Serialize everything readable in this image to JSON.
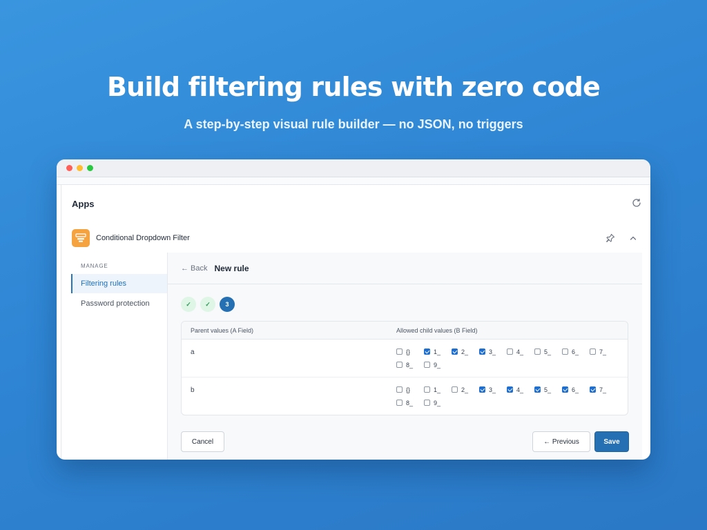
{
  "hero": {
    "title": "Build filtering rules with zero code",
    "subtitle": "A step-by-step visual rule builder — no JSON, no triggers"
  },
  "window": {
    "controls": [
      "close",
      "minimize",
      "maximize"
    ]
  },
  "apps": {
    "header": "Apps",
    "refresh_icon": "refresh-icon"
  },
  "app": {
    "name": "Conditional Dropdown Filter",
    "logo_color": "#f5a340",
    "pin_icon": "pin-icon",
    "collapse_icon": "chevron-up-icon"
  },
  "sidebar": {
    "section": "MANAGE",
    "items": [
      {
        "label": "Filtering rules",
        "active": true
      },
      {
        "label": "Password protection",
        "active": false
      }
    ]
  },
  "content": {
    "back_label": "← Back",
    "title": "New rule",
    "steps": [
      {
        "label": "✓",
        "state": "done"
      },
      {
        "label": "✓",
        "state": "done"
      },
      {
        "label": "3",
        "state": "current"
      }
    ],
    "table": {
      "col_a": "Parent values (A Field)",
      "col_b": "Allowed child values (B Field)",
      "rows": [
        {
          "parent": "a",
          "options": [
            {
              "label": "{}",
              "checked": false
            },
            {
              "label": "1_",
              "checked": true
            },
            {
              "label": "2_",
              "checked": true
            },
            {
              "label": "3_",
              "checked": true
            },
            {
              "label": "4_",
              "checked": false
            },
            {
              "label": "5_",
              "checked": false
            },
            {
              "label": "6_",
              "checked": false
            },
            {
              "label": "7_",
              "checked": false
            },
            {
              "label": "8_",
              "checked": false
            },
            {
              "label": "9_",
              "checked": false
            }
          ]
        },
        {
          "parent": "b",
          "options": [
            {
              "label": "{}",
              "checked": false
            },
            {
              "label": "1_",
              "checked": false
            },
            {
              "label": "2_",
              "checked": false
            },
            {
              "label": "3_",
              "checked": true
            },
            {
              "label": "4_",
              "checked": true
            },
            {
              "label": "5_",
              "checked": true
            },
            {
              "label": "6_",
              "checked": true
            },
            {
              "label": "7_",
              "checked": true
            },
            {
              "label": "8_",
              "checked": false
            },
            {
              "label": "9_",
              "checked": false
            }
          ]
        }
      ]
    },
    "buttons": {
      "cancel": "Cancel",
      "previous": "← Previous",
      "save": "Save"
    }
  },
  "colors": {
    "accent": "#2570b3",
    "checkbox_checked": "#1f6fd0",
    "step_done_bg": "#dff5e6"
  }
}
